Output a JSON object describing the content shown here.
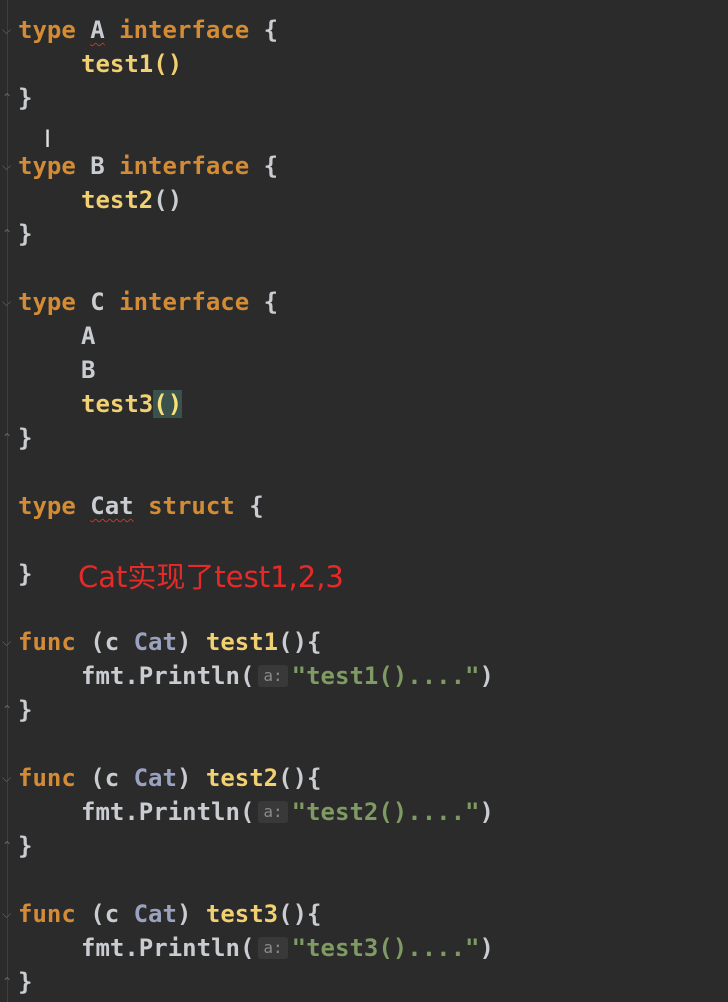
{
  "code": {
    "block_a": {
      "kw_type": "type",
      "name": "A",
      "kw_interface": "interface",
      "open_brace": "{",
      "method": "test1",
      "parens": "()",
      "close_brace": "}"
    },
    "block_b": {
      "kw_type": "type",
      "name": "B",
      "kw_interface": "interface",
      "open_brace": "{",
      "method": "test2",
      "parens": "()",
      "close_brace": "}"
    },
    "block_c": {
      "kw_type": "type",
      "name": "C",
      "kw_interface": "interface",
      "open_brace": "{",
      "embed_a": "A",
      "embed_b": "B",
      "method": "test3",
      "parens": "()",
      "close_brace": "}"
    },
    "block_cat": {
      "kw_type": "type",
      "name": "Cat",
      "kw_struct": "struct",
      "open_brace": "{",
      "close_brace": "}"
    },
    "func1": {
      "kw_func": "func",
      "recv_open": "(c ",
      "recv_type": "Cat",
      "recv_close": ")",
      "name": "test1",
      "sig": "(){",
      "call": "fmt.Println(",
      "hint": "a:",
      "arg": "\"test1()....\"",
      "call_close": ")",
      "close_brace": "}"
    },
    "func2": {
      "kw_func": "func",
      "recv_open": "(c ",
      "recv_type": "Cat",
      "recv_close": ")",
      "name": "test2",
      "sig": "(){",
      "call": "fmt.Println(",
      "hint": "a:",
      "arg": "\"test2()....\"",
      "call_close": ")",
      "close_brace": "}"
    },
    "func3": {
      "kw_func": "func",
      "recv_open": "(c ",
      "recv_type": "Cat",
      "recv_close": ")",
      "name": "test3",
      "sig": "(){",
      "call": "fmt.Println(",
      "hint": "a:",
      "arg": "\"test3()....\"",
      "call_close": ")",
      "close_brace": "}"
    }
  },
  "annotation": {
    "text": "Cat实现了test1,2,3"
  },
  "colors": {
    "background": "#2b2b2b",
    "keyword": "#d38b35",
    "string": "#7f9a62",
    "annotation": "#e52a2a"
  }
}
